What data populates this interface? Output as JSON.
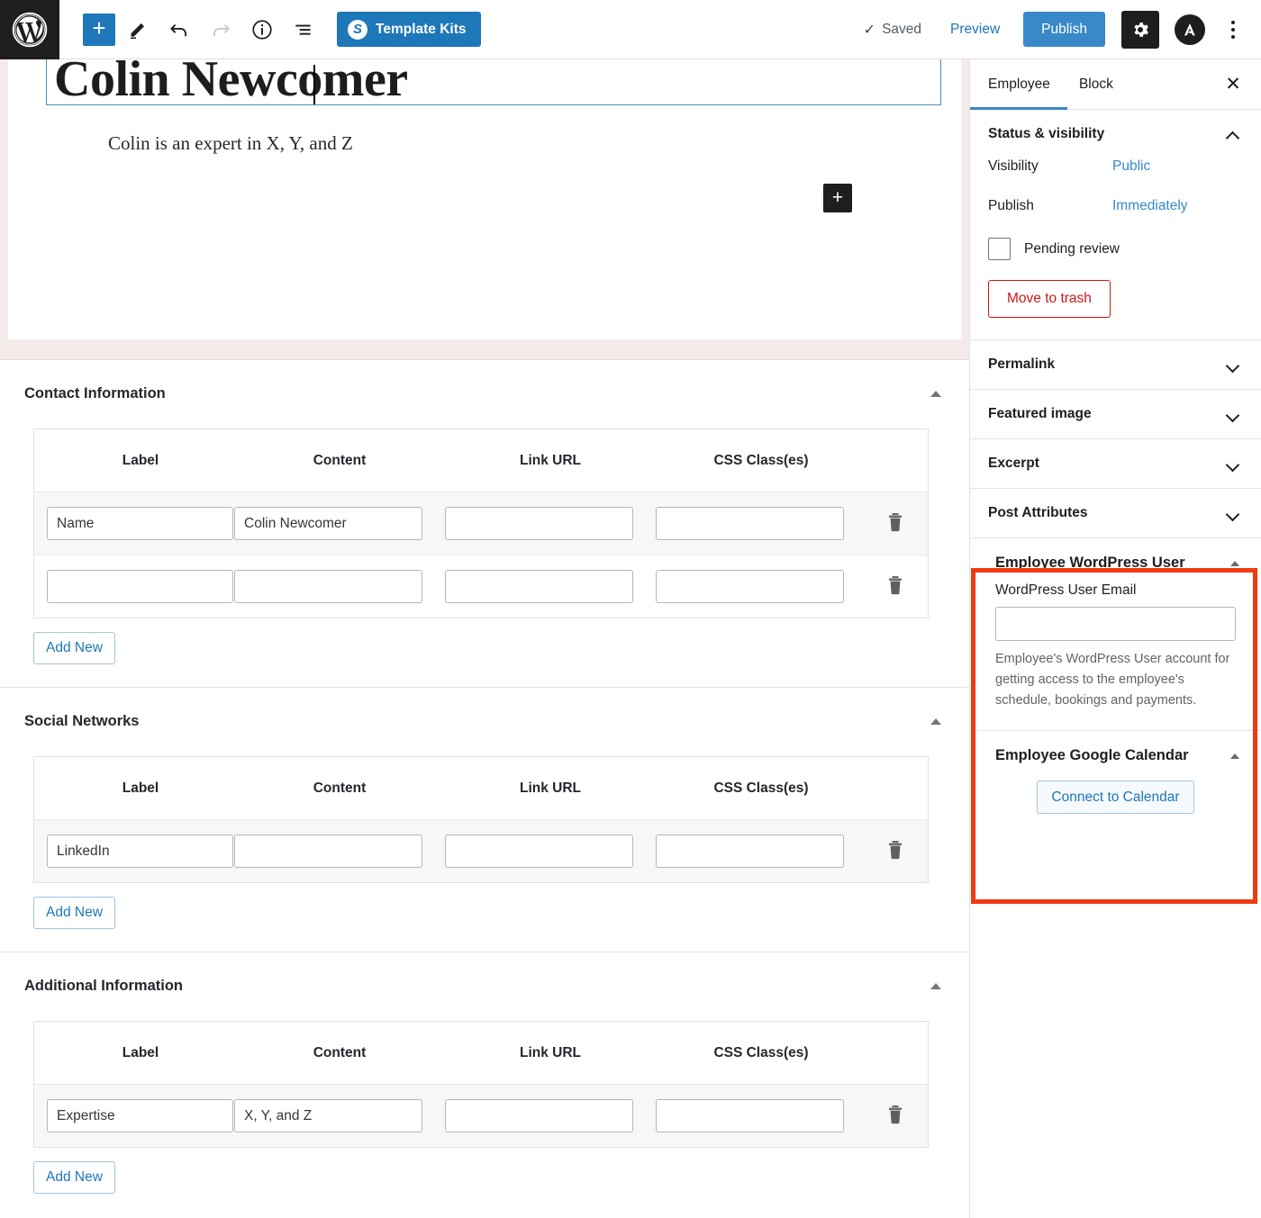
{
  "toolbar": {
    "logo_icon": "wordpress-logo-icon",
    "add_block_label": "+",
    "tools_icon": "pencil-icon",
    "undo_icon": "undo-icon",
    "redo_icon": "redo-icon",
    "info_icon": "info-icon",
    "list_view_icon": "list-view-icon",
    "template_kits_label": "Template Kits",
    "template_kits_badge": "S",
    "saved_label": "Saved",
    "saved_check": "✓",
    "preview_label": "Preview",
    "publish_label": "Publish",
    "settings_icon": "gear-icon",
    "astra_icon": "astra-logo-icon",
    "more_icon": "kebab-menu-icon",
    "accent_blue": "#1e77b8",
    "publish_blue": "#3988c8"
  },
  "editor": {
    "post_title": "Colin Newcomer",
    "paragraph": "Colin is an expert in X, Y, and Z",
    "appender_label": "+",
    "canvas_bg": "#f5eaea"
  },
  "metaboxes": [
    {
      "title": "Contact Information",
      "columns": [
        "Label",
        "Content",
        "Link URL",
        "CSS Class(es)"
      ],
      "rows": [
        {
          "label": "Name",
          "content": "Colin Newcomer",
          "link_url": "",
          "css_class": ""
        },
        {
          "label": "",
          "content": "",
          "link_url": "",
          "css_class": ""
        }
      ],
      "add_new_label": "Add New",
      "delete_icon": "trash-icon",
      "toggle_icon": "triangle-up-icon"
    },
    {
      "title": "Social Networks",
      "columns": [
        "Label",
        "Content",
        "Link URL",
        "CSS Class(es)"
      ],
      "rows": [
        {
          "label": "LinkedIn",
          "content": "",
          "link_url": "",
          "css_class": ""
        }
      ],
      "add_new_label": "Add New",
      "delete_icon": "trash-icon",
      "toggle_icon": "triangle-up-icon"
    },
    {
      "title": "Additional Information",
      "columns": [
        "Label",
        "Content",
        "Link URL",
        "CSS Class(es)"
      ],
      "rows": [
        {
          "label": "Expertise",
          "content": "X, Y, and Z",
          "link_url": "",
          "css_class": ""
        }
      ],
      "add_new_label": "Add New",
      "delete_icon": "trash-icon",
      "toggle_icon": "triangle-up-icon"
    }
  ],
  "sidebar": {
    "tabs": [
      {
        "label": "Employee",
        "active": true
      },
      {
        "label": "Block",
        "active": false
      }
    ],
    "close_icon": "close-icon",
    "status_panel": {
      "title": "Status & visibility",
      "visibility_label": "Visibility",
      "visibility_value": "Public",
      "publish_label": "Publish",
      "publish_value": "Immediately",
      "pending_review_label": "Pending review",
      "pending_review_checked": false,
      "trash_label": "Move to trash",
      "trash_color": "#cc1818"
    },
    "collapsed_panels": [
      {
        "title": "Permalink"
      },
      {
        "title": "Featured image"
      },
      {
        "title": "Excerpt"
      },
      {
        "title": "Post Attributes"
      }
    ],
    "wp_user_panel": {
      "title": "Employee WordPress User",
      "field_label": "WordPress User Email",
      "field_value": "",
      "help_text": "Employee's WordPress User account for getting access to the employee's schedule, bookings and payments."
    },
    "gcal_panel": {
      "title": "Employee Google Calendar",
      "button_label": "Connect to Calendar"
    },
    "highlight_color": "#f03a10"
  }
}
